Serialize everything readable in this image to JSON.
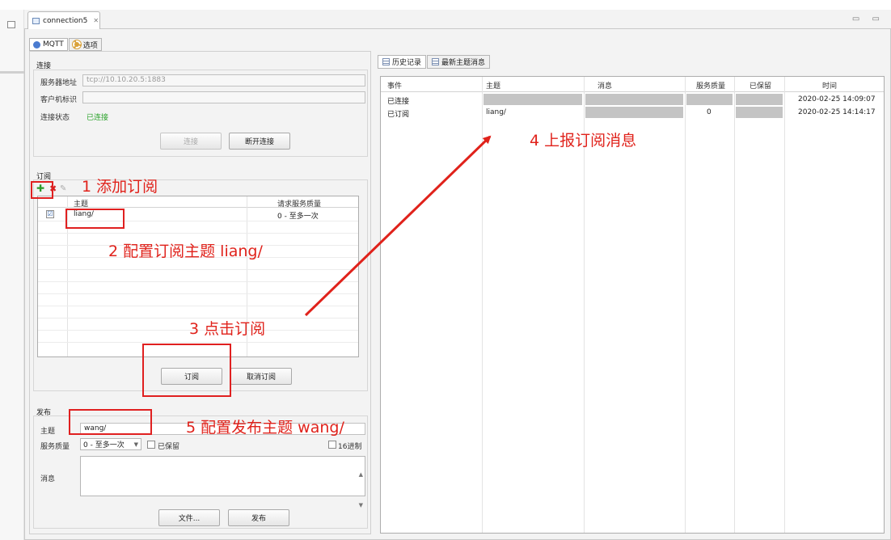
{
  "editor_tab": "connection5",
  "tabs": {
    "mqtt": "MQTT",
    "options": "选项"
  },
  "connection": {
    "section": "连接",
    "server_label": "服务器地址",
    "server_value": "tcp://10.10.20.5:1883",
    "client_label": "客户机标识",
    "client_value": "",
    "status_label": "连接状态",
    "status_value": "已连接",
    "connect_btn": "连接",
    "disconnect_btn": "断开连接"
  },
  "subscribe": {
    "section": "订阅",
    "col_topic": "主题",
    "col_qos": "请求服务质量",
    "rows": [
      {
        "checked": "☑",
        "topic": "liang/",
        "qos": "0 - 至多一次"
      }
    ],
    "subscribe_btn": "订阅",
    "unsubscribe_btn": "取消订阅"
  },
  "publish": {
    "section": "发布",
    "topic_label": "主题",
    "topic_value": "wang/",
    "qos_label": "服务质量",
    "qos_value": "0 - 至多一次",
    "retain_label": "已保留",
    "hex_label": "16进制",
    "message_label": "消息",
    "file_btn": "文件...",
    "publish_btn": "发布"
  },
  "history": {
    "tab_history": "历史记录",
    "tab_latest": "最新主题消息",
    "columns": [
      "事件",
      "主题",
      "消息",
      "服务质量",
      "已保留",
      "时间"
    ],
    "rows": [
      {
        "event": "已连接",
        "topic": "",
        "message": "",
        "qos": "",
        "retained": "",
        "time": "2020-02-25 14:09:07"
      },
      {
        "event": "已订阅",
        "topic": "liang/",
        "message": "",
        "qos": "0",
        "retained": "",
        "time": "2020-02-25 14:14:17"
      }
    ]
  },
  "annotations": {
    "a1": "1 添加订阅",
    "a2": "2 配置订阅主题  liang/",
    "a3": "3 点击订阅",
    "a4": "4 上报订阅消息",
    "a5": "5 配置发布主题  wang/"
  },
  "colors": {
    "annotation": "#e0221b",
    "status_ok": "#2aa22a"
  }
}
